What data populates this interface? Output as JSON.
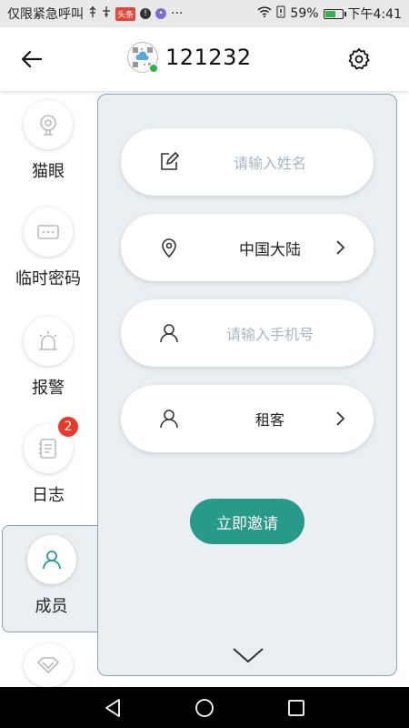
{
  "status_bar": {
    "carrier": "仅限紧急呼叫",
    "app_badge": "头条",
    "more": "···",
    "battery": "59%",
    "battery_level": 0.59,
    "time": "下午4:41"
  },
  "header": {
    "title": "121232",
    "back_icon": "back-arrow-icon",
    "settings_icon": "gear-icon"
  },
  "sidebar": {
    "items": [
      {
        "label": "猫眼",
        "icon": "camera-icon"
      },
      {
        "label": "临时密码",
        "icon": "password-icon"
      },
      {
        "label": "报警",
        "icon": "alarm-icon"
      },
      {
        "label": "日志",
        "icon": "log-icon",
        "badge": "2"
      },
      {
        "label": "成员",
        "icon": "member-icon",
        "active": true
      },
      {
        "label": "",
        "icon": "diamond-icon"
      }
    ]
  },
  "form": {
    "name_placeholder": "请输入姓名",
    "region_value": "中国大陆",
    "phone_placeholder": "请输入手机号",
    "role_value": "租客",
    "invite_label": "立即邀请"
  },
  "colors": {
    "accent": "#279a8a",
    "panel_bg": "#e9eff2",
    "badge": "#e8392b"
  }
}
